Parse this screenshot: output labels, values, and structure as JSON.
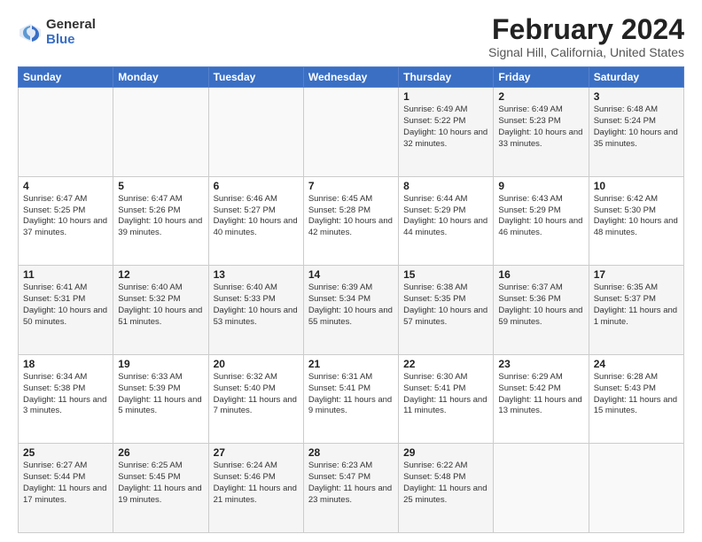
{
  "logo": {
    "general": "General",
    "blue": "Blue"
  },
  "title": "February 2024",
  "location": "Signal Hill, California, United States",
  "days_header": [
    "Sunday",
    "Monday",
    "Tuesday",
    "Wednesday",
    "Thursday",
    "Friday",
    "Saturday"
  ],
  "weeks": [
    [
      {
        "day": "",
        "detail": ""
      },
      {
        "day": "",
        "detail": ""
      },
      {
        "day": "",
        "detail": ""
      },
      {
        "day": "",
        "detail": ""
      },
      {
        "day": "1",
        "detail": "Sunrise: 6:49 AM\nSunset: 5:22 PM\nDaylight: 10 hours\nand 32 minutes."
      },
      {
        "day": "2",
        "detail": "Sunrise: 6:49 AM\nSunset: 5:23 PM\nDaylight: 10 hours\nand 33 minutes."
      },
      {
        "day": "3",
        "detail": "Sunrise: 6:48 AM\nSunset: 5:24 PM\nDaylight: 10 hours\nand 35 minutes."
      }
    ],
    [
      {
        "day": "4",
        "detail": "Sunrise: 6:47 AM\nSunset: 5:25 PM\nDaylight: 10 hours\nand 37 minutes."
      },
      {
        "day": "5",
        "detail": "Sunrise: 6:47 AM\nSunset: 5:26 PM\nDaylight: 10 hours\nand 39 minutes."
      },
      {
        "day": "6",
        "detail": "Sunrise: 6:46 AM\nSunset: 5:27 PM\nDaylight: 10 hours\nand 40 minutes."
      },
      {
        "day": "7",
        "detail": "Sunrise: 6:45 AM\nSunset: 5:28 PM\nDaylight: 10 hours\nand 42 minutes."
      },
      {
        "day": "8",
        "detail": "Sunrise: 6:44 AM\nSunset: 5:29 PM\nDaylight: 10 hours\nand 44 minutes."
      },
      {
        "day": "9",
        "detail": "Sunrise: 6:43 AM\nSunset: 5:29 PM\nDaylight: 10 hours\nand 46 minutes."
      },
      {
        "day": "10",
        "detail": "Sunrise: 6:42 AM\nSunset: 5:30 PM\nDaylight: 10 hours\nand 48 minutes."
      }
    ],
    [
      {
        "day": "11",
        "detail": "Sunrise: 6:41 AM\nSunset: 5:31 PM\nDaylight: 10 hours\nand 50 minutes."
      },
      {
        "day": "12",
        "detail": "Sunrise: 6:40 AM\nSunset: 5:32 PM\nDaylight: 10 hours\nand 51 minutes."
      },
      {
        "day": "13",
        "detail": "Sunrise: 6:40 AM\nSunset: 5:33 PM\nDaylight: 10 hours\nand 53 minutes."
      },
      {
        "day": "14",
        "detail": "Sunrise: 6:39 AM\nSunset: 5:34 PM\nDaylight: 10 hours\nand 55 minutes."
      },
      {
        "day": "15",
        "detail": "Sunrise: 6:38 AM\nSunset: 5:35 PM\nDaylight: 10 hours\nand 57 minutes."
      },
      {
        "day": "16",
        "detail": "Sunrise: 6:37 AM\nSunset: 5:36 PM\nDaylight: 10 hours\nand 59 minutes."
      },
      {
        "day": "17",
        "detail": "Sunrise: 6:35 AM\nSunset: 5:37 PM\nDaylight: 11 hours\nand 1 minute."
      }
    ],
    [
      {
        "day": "18",
        "detail": "Sunrise: 6:34 AM\nSunset: 5:38 PM\nDaylight: 11 hours\nand 3 minutes."
      },
      {
        "day": "19",
        "detail": "Sunrise: 6:33 AM\nSunset: 5:39 PM\nDaylight: 11 hours\nand 5 minutes."
      },
      {
        "day": "20",
        "detail": "Sunrise: 6:32 AM\nSunset: 5:40 PM\nDaylight: 11 hours\nand 7 minutes."
      },
      {
        "day": "21",
        "detail": "Sunrise: 6:31 AM\nSunset: 5:41 PM\nDaylight: 11 hours\nand 9 minutes."
      },
      {
        "day": "22",
        "detail": "Sunrise: 6:30 AM\nSunset: 5:41 PM\nDaylight: 11 hours\nand 11 minutes."
      },
      {
        "day": "23",
        "detail": "Sunrise: 6:29 AM\nSunset: 5:42 PM\nDaylight: 11 hours\nand 13 minutes."
      },
      {
        "day": "24",
        "detail": "Sunrise: 6:28 AM\nSunset: 5:43 PM\nDaylight: 11 hours\nand 15 minutes."
      }
    ],
    [
      {
        "day": "25",
        "detail": "Sunrise: 6:27 AM\nSunset: 5:44 PM\nDaylight: 11 hours\nand 17 minutes."
      },
      {
        "day": "26",
        "detail": "Sunrise: 6:25 AM\nSunset: 5:45 PM\nDaylight: 11 hours\nand 19 minutes."
      },
      {
        "day": "27",
        "detail": "Sunrise: 6:24 AM\nSunset: 5:46 PM\nDaylight: 11 hours\nand 21 minutes."
      },
      {
        "day": "28",
        "detail": "Sunrise: 6:23 AM\nSunset: 5:47 PM\nDaylight: 11 hours\nand 23 minutes."
      },
      {
        "day": "29",
        "detail": "Sunrise: 6:22 AM\nSunset: 5:48 PM\nDaylight: 11 hours\nand 25 minutes."
      },
      {
        "day": "",
        "detail": ""
      },
      {
        "day": "",
        "detail": ""
      }
    ]
  ]
}
